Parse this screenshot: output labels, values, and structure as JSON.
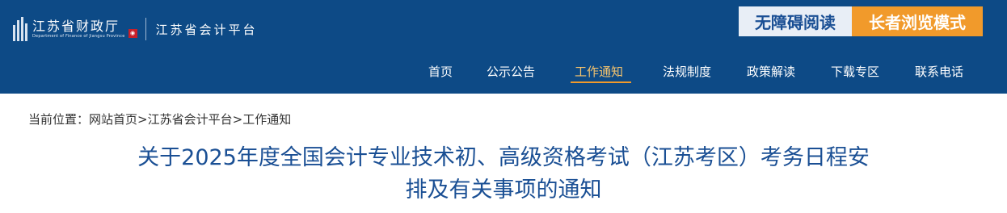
{
  "header": {
    "logo": {
      "name_cn": "江苏省财政厅",
      "name_en": "Department of Finance of Jiangsu Province",
      "platform": "江苏省会计平台"
    },
    "accessibility_button": "无障碍阅读",
    "elder_mode_button": "长者浏览模式",
    "accessibility_colors": {
      "accessible_bg": "#e8eef6",
      "elder_bg": "#f19a2b"
    },
    "nav": [
      {
        "label": "首页"
      },
      {
        "label": "公示公告"
      },
      {
        "label": "工作通知",
        "active": true
      },
      {
        "label": "法规制度"
      },
      {
        "label": "政策解读"
      },
      {
        "label": "下载专区"
      },
      {
        "label": "联系电话"
      }
    ],
    "bg_color": "#0d4a86"
  },
  "breadcrumb": {
    "prefix": "当前位置：",
    "items": [
      "网站首页",
      ">",
      "江苏省会计平台",
      ">",
      "工作通知"
    ]
  },
  "article": {
    "title_line1": "关于2025年度全国会计专业技术初、高级资格考试（江苏考区）考务日程安",
    "title_line2": "排及有关事项的通知",
    "title_color": "#1a4f94"
  }
}
